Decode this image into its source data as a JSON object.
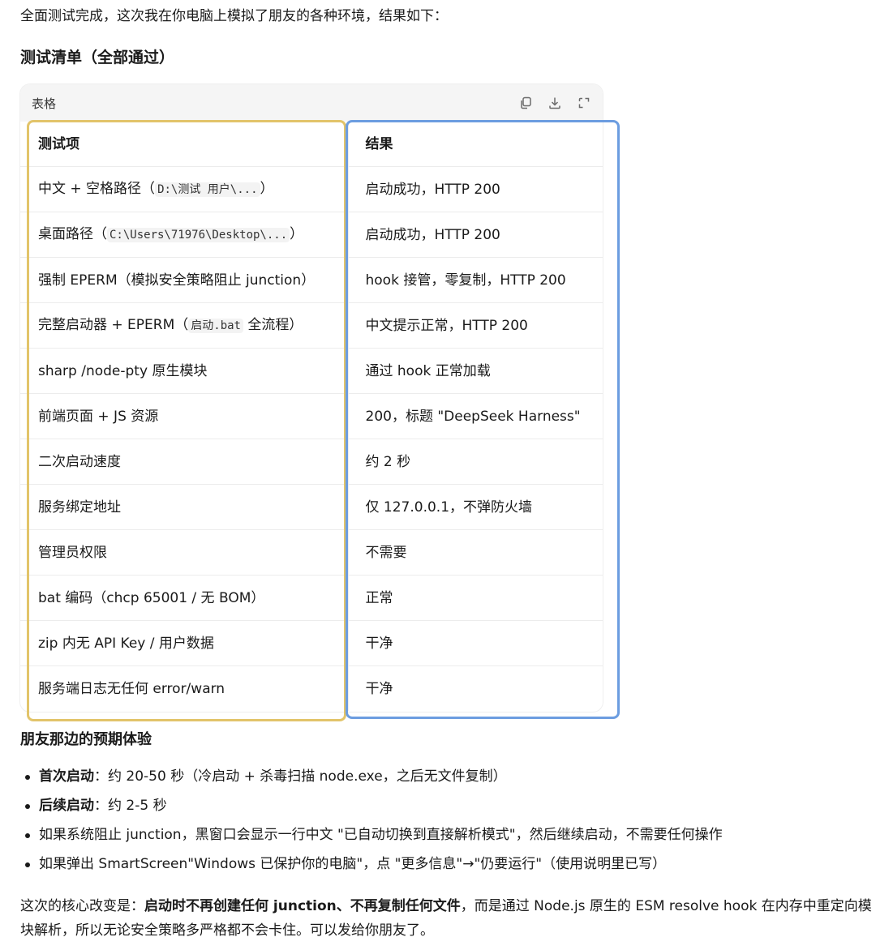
{
  "intro": "全面测试完成，这次我在你电脑上模拟了朋友的各种环境，结果如下：",
  "tests_heading": "测试清单（全部通过）",
  "table": {
    "toolbar_label": "表格",
    "headers": [
      "测试项",
      "结果"
    ],
    "rows": [
      {
        "pre": "中文 + 空格路径（",
        "code": "D:\\测试 用户\\...",
        "post": "）",
        "result": "启动成功，HTTP 200"
      },
      {
        "pre": "桌面路径（",
        "code": "C:\\Users\\71976\\Desktop\\...",
        "post": "）",
        "result": "启动成功，HTTP 200"
      },
      {
        "pre": "强制 EPERM（模拟安全策略阻止 junction）",
        "code": "",
        "post": "",
        "result": "hook 接管，零复制，HTTP 200"
      },
      {
        "pre": "完整启动器 + EPERM（",
        "code": "启动.bat",
        "post": " 全流程）",
        "result": "中文提示正常，HTTP 200"
      },
      {
        "pre": "sharp /node-pty 原生模块",
        "code": "",
        "post": "",
        "result": "通过 hook 正常加载"
      },
      {
        "pre": "前端页面 + JS 资源",
        "code": "",
        "post": "",
        "result": "200，标题 \"DeepSeek Harness\""
      },
      {
        "pre": "二次启动速度",
        "code": "",
        "post": "",
        "result": "约 2 秒"
      },
      {
        "pre": "服务绑定地址",
        "code": "",
        "post": "",
        "result": "仅 127.0.0.1，不弹防火墙"
      },
      {
        "pre": "管理员权限",
        "code": "",
        "post": "",
        "result": "不需要"
      },
      {
        "pre": "bat 编码（chcp 65001 / 无 BOM）",
        "code": "",
        "post": "",
        "result": "正常"
      },
      {
        "pre": "zip 内无 API Key / 用户数据",
        "code": "",
        "post": "",
        "result": "干净"
      },
      {
        "pre": "服务端日志无任何 error/warn",
        "code": "",
        "post": "",
        "result": "干净"
      }
    ],
    "tool_icons": [
      "copy-icon",
      "download-icon",
      "expand-icon"
    ]
  },
  "experience_heading": "朋友那边的预期体验",
  "experience_items": [
    {
      "bold": "首次启动",
      "text": "：约 20-50 秒（冷启动 + 杀毒扫描 node.exe，之后无文件复制）"
    },
    {
      "bold": "后续启动",
      "text": "：约 2-5 秒"
    },
    {
      "bold": "",
      "text": "如果系统阻止 junction，黑窗口会显示一行中文 \"已自动切换到直接解析模式\"，然后继续启动，不需要任何操作"
    },
    {
      "bold": "",
      "text": "如果弹出 SmartScreen\"Windows 已保护你的电脑\"，点 \"更多信息\"→\"仍要运行\"（使用说明里已写）"
    }
  ],
  "summary": {
    "pre": "这次的核心改变是：",
    "bold": "启动时不再创建任何 junction、不再复制任何文件",
    "post": "，而是通过 Node.js 原生的 ESM resolve hook 在内存中重定向模块解析，所以无论安全策略多严格都不会卡住。可以发给你朋友了。"
  },
  "colors": {
    "highlight_left": "#e2c46a",
    "highlight_right": "#6c9de0",
    "toolbar_bg": "#f5f5f5"
  }
}
